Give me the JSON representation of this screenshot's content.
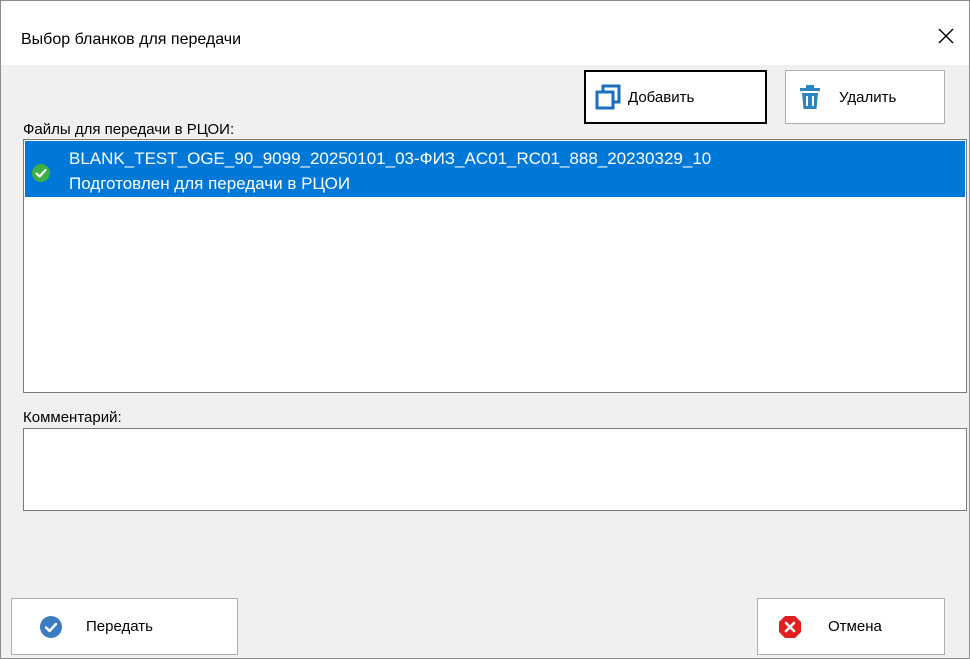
{
  "window": {
    "title": "Выбор бланков для передачи"
  },
  "toolbar": {
    "add_label": "Добавить",
    "delete_label": "Удалить"
  },
  "files": {
    "label": "Файлы для передачи в РЦОИ",
    "items": [
      {
        "name": "BLANK_TEST_OGE_90_9099_20250101_03-ФИЗ_AC01_RC01_888_20230329_10",
        "status": "Подготовлен для передачи в РЦОИ",
        "selected": true,
        "status_icon": "check-circle-icon"
      }
    ]
  },
  "comment": {
    "label": "Комментарий:",
    "value": ""
  },
  "footer": {
    "send_label": "Передать",
    "cancel_label": "Отмена"
  },
  "colors": {
    "selection": "#0078d7",
    "success": "#3cb043",
    "send_icon": "#3b7bbf",
    "cancel_icon": "#e02020",
    "add_icon": "#1a6fbf",
    "delete_icon": "#2e86c1"
  }
}
